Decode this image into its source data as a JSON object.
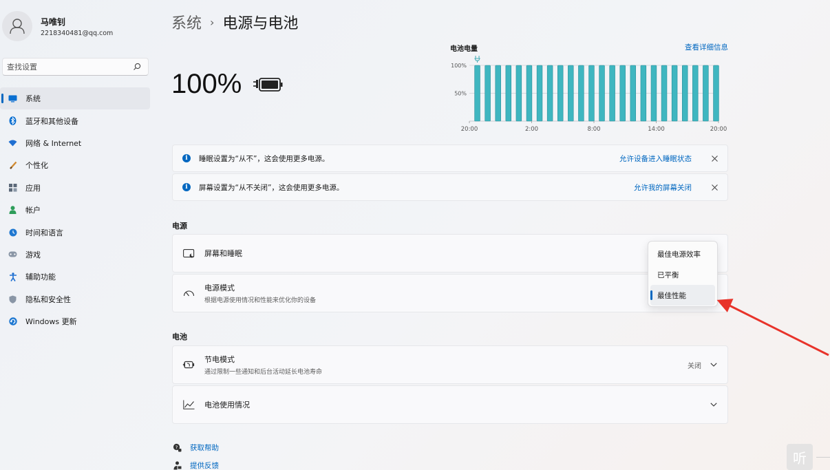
{
  "user": {
    "name": "马唯钊",
    "email": "2218340481@qq.com"
  },
  "search": {
    "placeholder": "查找设置"
  },
  "nav": [
    {
      "label": "系统",
      "icon": "monitor-icon",
      "active": true
    },
    {
      "label": "蓝牙和其他设备",
      "icon": "bluetooth-icon"
    },
    {
      "label": "网络 & Internet",
      "icon": "wifi-icon"
    },
    {
      "label": "个性化",
      "icon": "brush-icon"
    },
    {
      "label": "应用",
      "icon": "apps-icon"
    },
    {
      "label": "帐户",
      "icon": "person-icon"
    },
    {
      "label": "时间和语言",
      "icon": "globe-clock-icon"
    },
    {
      "label": "游戏",
      "icon": "gamepad-icon"
    },
    {
      "label": "辅助功能",
      "icon": "accessibility-icon"
    },
    {
      "label": "隐私和安全性",
      "icon": "shield-icon"
    },
    {
      "label": "Windows 更新",
      "icon": "update-icon"
    }
  ],
  "breadcrumb": {
    "parent": "系统",
    "separator": "›",
    "current": "电源与电池"
  },
  "battery": {
    "percent": "100%"
  },
  "chart_data": {
    "type": "bar",
    "title": "电池电量",
    "link": "查看详细信息",
    "x_tick_labels": [
      "20:00",
      "2:00",
      "8:00",
      "14:00",
      "20:00"
    ],
    "y_tick_labels": [
      "100%",
      "50%"
    ],
    "ylim": [
      0,
      100
    ],
    "bar_count": 24,
    "values": [
      100,
      100,
      100,
      100,
      100,
      100,
      100,
      100,
      100,
      100,
      100,
      100,
      100,
      100,
      100,
      100,
      100,
      100,
      100,
      100,
      100,
      100,
      100,
      100
    ],
    "bar_color": "#3fb6c0",
    "bar_edge_color": "#2a8f99",
    "charging_marker": "plug-icon"
  },
  "notices": [
    {
      "text": "睡眠设置为“从不”，这会使用更多电源。",
      "link": "允许设备进入睡眠状态"
    },
    {
      "text": "屏幕设置为“从不关闭”，这会使用更多电源。",
      "link": "允许我的屏幕关闭"
    }
  ],
  "sections": {
    "power": "电源",
    "battery": "电池"
  },
  "cards": {
    "screen_sleep": {
      "title": "屏幕和睡眠"
    },
    "power_mode": {
      "title": "电源模式",
      "subtitle": "根据电源使用情况和性能来优化你的设备"
    },
    "battery_saver": {
      "title": "节电模式",
      "subtitle": "通过限制一些通知和后台活动延长电池寿命",
      "value": "关闭"
    },
    "battery_usage": {
      "title": "电池使用情况"
    }
  },
  "power_mode_dropdown": {
    "options": [
      "最佳电源效率",
      "已平衡",
      "最佳性能"
    ],
    "selected": "最佳性能"
  },
  "footer": {
    "help": "获取帮助",
    "feedback": "提供反馈"
  },
  "overlay": {
    "listen_glyph": "听"
  },
  "colors": {
    "accent": "#0067c0",
    "annotation_arrow": "#e8332a"
  }
}
